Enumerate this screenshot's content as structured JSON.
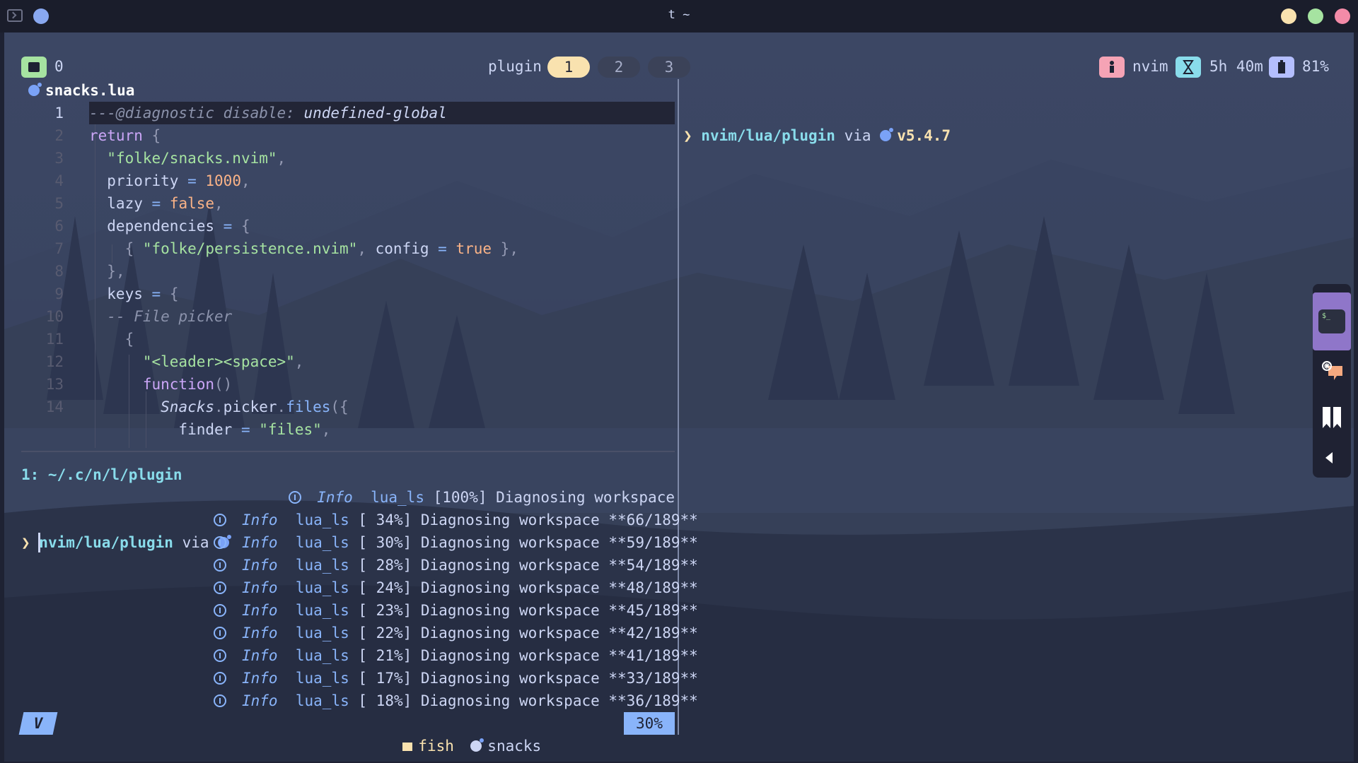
{
  "window": {
    "title": "t ~",
    "accent_colors": {
      "close": "#f38ba8",
      "minimize": "#f9e2af",
      "maximize": "#a6e3a1",
      "app_dot": "#89a8f0"
    }
  },
  "tmux": {
    "session_number": "0",
    "window_name": "plugin",
    "windows": [
      "1",
      "2",
      "3"
    ],
    "active_window": "1",
    "status": {
      "process": "nvim",
      "elapsed": "5h 40m",
      "battery": "81%"
    }
  },
  "editor": {
    "filename": "snacks.lua",
    "filetype_icon": "lua-icon",
    "current_line_number": "1",
    "line_numbers": [
      "1",
      "2",
      "3",
      "4",
      "5",
      "6",
      "7",
      "8",
      "9",
      "10",
      "11",
      "12",
      "13",
      "14"
    ],
    "lines": [
      [
        {
          "t": "---@diagnostic ",
          "c": "c-comment"
        },
        {
          "t": "disable: ",
          "c": "c-comment"
        },
        {
          "t": "undefined-global",
          "c": "c-italicid"
        }
      ],
      [
        {
          "t": "return ",
          "c": "c-kw"
        },
        {
          "t": "{",
          "c": "c-punc"
        }
      ],
      [
        {
          "t": "  "
        },
        {
          "t": "\"folke/snacks.nvim\"",
          "c": "c-str"
        },
        {
          "t": ",",
          "c": "c-punc"
        }
      ],
      [
        {
          "t": "  priority "
        },
        {
          "t": "=",
          "c": "c-fn"
        },
        {
          "t": " "
        },
        {
          "t": "1000",
          "c": "c-num"
        },
        {
          "t": ",",
          "c": "c-punc"
        }
      ],
      [
        {
          "t": "  lazy "
        },
        {
          "t": "=",
          "c": "c-fn"
        },
        {
          "t": " "
        },
        {
          "t": "false",
          "c": "c-bool"
        },
        {
          "t": ",",
          "c": "c-punc"
        }
      ],
      [
        {
          "t": "  dependencies "
        },
        {
          "t": "=",
          "c": "c-fn"
        },
        {
          "t": " "
        },
        {
          "t": "{",
          "c": "c-punc"
        }
      ],
      [
        {
          "t": "    "
        },
        {
          "t": "{",
          "c": "c-punc"
        },
        {
          "t": " "
        },
        {
          "t": "\"folke/persistence.nvim\"",
          "c": "c-str"
        },
        {
          "t": ", ",
          "c": "c-punc"
        },
        {
          "t": "config "
        },
        {
          "t": "=",
          "c": "c-fn"
        },
        {
          "t": " "
        },
        {
          "t": "true",
          "c": "c-bool"
        },
        {
          "t": " }",
          "c": "c-punc"
        },
        {
          "t": ",",
          "c": "c-punc"
        }
      ],
      [
        {
          "t": "  "
        },
        {
          "t": "}",
          "c": "c-punc"
        },
        {
          "t": ",",
          "c": "c-punc"
        }
      ],
      [
        {
          "t": "  keys "
        },
        {
          "t": "=",
          "c": "c-fn"
        },
        {
          "t": " "
        },
        {
          "t": "{",
          "c": "c-punc"
        }
      ],
      [
        {
          "t": "  "
        },
        {
          "t": "-- File picker",
          "c": "c-comment"
        }
      ],
      [
        {
          "t": "    "
        },
        {
          "t": "{",
          "c": "c-punc"
        }
      ],
      [
        {
          "t": "      "
        },
        {
          "t": "\"<leader><space>\"",
          "c": "c-str"
        },
        {
          "t": ",",
          "c": "c-punc"
        }
      ],
      [
        {
          "t": "      "
        },
        {
          "t": "function",
          "c": "c-kw"
        },
        {
          "t": "()",
          "c": "c-punc"
        }
      ],
      [
        {
          "t": "        "
        },
        {
          "t": "Snacks",
          "c": "c-italicid"
        },
        {
          "t": ".",
          "c": "c-punc"
        },
        {
          "t": "picker"
        },
        {
          "t": ".",
          "c": "c-punc"
        },
        {
          "t": "files",
          "c": "c-fn"
        },
        {
          "t": "({",
          "c": "c-punc"
        }
      ],
      [
        {
          "t": "          finder "
        },
        {
          "t": "=",
          "c": "c-fn"
        },
        {
          "t": " "
        },
        {
          "t": "\"files\"",
          "c": "c-str"
        },
        {
          "t": ",",
          "c": "c-punc"
        }
      ]
    ]
  },
  "terminal": {
    "buffer_title": "1: ~/.c/n/l/plugin",
    "prompt_path": "nvim/lua/plugin",
    "prompt_via": "via",
    "prompt_symbol": "❯"
  },
  "notifications": [
    {
      "level": "Info",
      "source": "lua_ls",
      "message": "[100%] Diagnosing workspace"
    },
    {
      "level": "Info",
      "source": "lua_ls",
      "message": "[ 34%] Diagnosing workspace **66/189**"
    },
    {
      "level": "Info",
      "source": "lua_ls",
      "message": "[ 30%] Diagnosing workspace **59/189**"
    },
    {
      "level": "Info",
      "source": "lua_ls",
      "message": "[ 28%] Diagnosing workspace **54/189**"
    },
    {
      "level": "Info",
      "source": "lua_ls",
      "message": "[ 24%] Diagnosing workspace **48/189**"
    },
    {
      "level": "Info",
      "source": "lua_ls",
      "message": "[ 23%] Diagnosing workspace **45/189**"
    },
    {
      "level": "Info",
      "source": "lua_ls",
      "message": "[ 22%] Diagnosing workspace **42/189**"
    },
    {
      "level": "Info",
      "source": "lua_ls",
      "message": "[ 21%] Diagnosing workspace **41/189**"
    },
    {
      "level": "Info",
      "source": "lua_ls",
      "message": "[ 17%] Diagnosing workspace **33/189**"
    },
    {
      "level": "Info",
      "source": "lua_ls",
      "message": "[ 18%] Diagnosing workspace **36/189**"
    }
  ],
  "statusline": {
    "mode": "V",
    "shell": "fish",
    "file": "snacks",
    "lsp": "lua_ls",
    "progress": "30%"
  },
  "right_pane": {
    "prompt_path": "nvim/lua/plugin",
    "prompt_via": "via",
    "lua_version": "v5.4.7",
    "prompt_symbol": "❯"
  },
  "dock": {
    "items": [
      "terminal-app-icon",
      "chat-app-icon",
      "bookmark-app-icon",
      "collapse-arrow-icon"
    ]
  }
}
